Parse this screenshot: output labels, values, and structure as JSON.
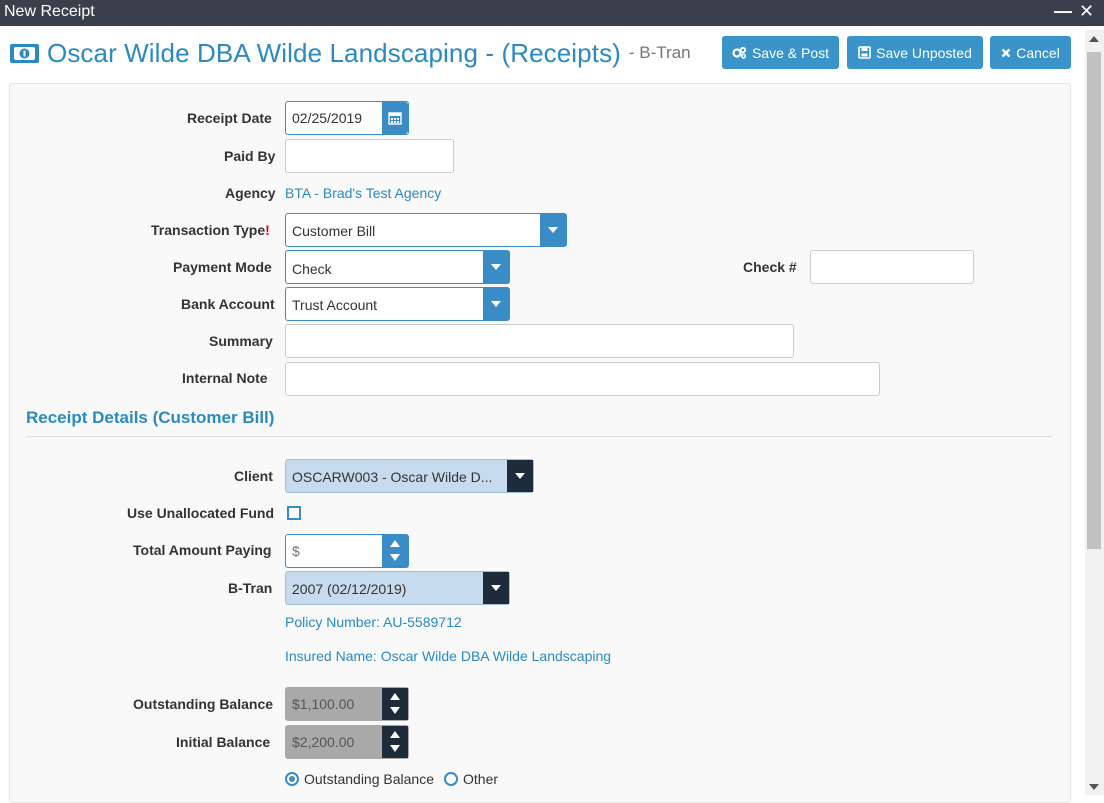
{
  "window": {
    "title": "New Receipt"
  },
  "header": {
    "title": "Oscar Wilde DBA Wilde Landscaping - (Receipts)",
    "subtitle": "- B-Tran",
    "icon": "money-icon",
    "buttons": {
      "save_post": "Save & Post",
      "save_unposted": "Save Unposted",
      "cancel": "Cancel"
    }
  },
  "colors": {
    "accent": "#3a8cc7",
    "link": "#2a8ac2",
    "titlebar": "#3a3f4b",
    "required": "#ee0000"
  },
  "form": {
    "receipt_date": {
      "label": "Receipt Date",
      "value": "02/25/2019"
    },
    "paid_by": {
      "label": "Paid By",
      "value": ""
    },
    "agency": {
      "label": "Agency",
      "value": "BTA - Brad's Test Agency"
    },
    "transaction_type": {
      "label": "Transaction Type",
      "required_mark": "!",
      "value": "Customer Bill"
    },
    "payment_mode": {
      "label": "Payment Mode",
      "value": "Check"
    },
    "check_number": {
      "label": "Check #",
      "value": ""
    },
    "bank_account": {
      "label": "Bank Account",
      "value": "Trust Account"
    },
    "summary": {
      "label": "Summary",
      "value": ""
    },
    "internal_note": {
      "label": "Internal Note",
      "value": ""
    }
  },
  "details": {
    "section_title": "Receipt Details (Customer Bill)",
    "client": {
      "label": "Client",
      "value": "OSCARW003 - Oscar Wilde D..."
    },
    "use_unallocated": {
      "label": "Use Unallocated Fund",
      "checked": false
    },
    "total_amount": {
      "label": "Total Amount Paying",
      "placeholder": "$"
    },
    "btran": {
      "label": "B-Tran",
      "value": "2007 (02/12/2019)"
    },
    "policy_number": "Policy Number: AU-5589712",
    "insured_name": "Insured Name: Oscar Wilde DBA Wilde Landscaping",
    "outstanding_balance": {
      "label": "Outstanding Balance",
      "value": "$1,100.00"
    },
    "initial_balance": {
      "label": "Initial Balance",
      "value": "$2,200.00"
    },
    "apply_options": [
      {
        "label": "Outstanding Balance",
        "selected": true
      },
      {
        "label": "Other",
        "selected": false
      }
    ]
  }
}
